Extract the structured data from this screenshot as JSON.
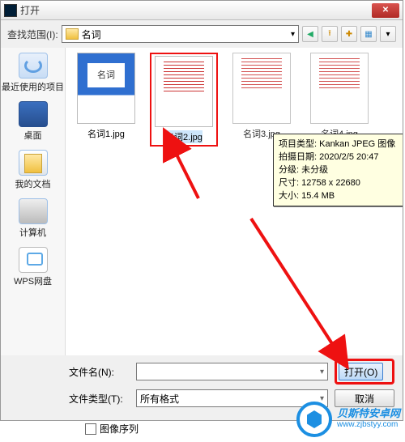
{
  "window": {
    "title": "打开"
  },
  "lookin": {
    "label": "查找范围(I):",
    "folder": "名词",
    "buttons": {
      "back": "←",
      "up": "↑",
      "new": "✚",
      "view": "▦",
      "extra": "▼"
    }
  },
  "sidebar": {
    "recent": "最近使用的项目",
    "desktop": "桌面",
    "mydocs": "我的文档",
    "computer": "计算机",
    "wps": "WPS网盘"
  },
  "files": [
    {
      "name": "名词1.jpg"
    },
    {
      "name": "名词2.jpg"
    },
    {
      "name": "名词3.jpg"
    },
    {
      "name": "名词4.jpg"
    }
  ],
  "tooltip": {
    "line1": "项目类型: Kankan JPEG 图像",
    "line2": "拍摄日期: 2020/2/5 20:47",
    "line3": "分级: 未分级",
    "line4": "尺寸: 12758 x 22680",
    "line5": "大小: 15.4 MB"
  },
  "bottom": {
    "filename_label": "文件名(N):",
    "filename_value": "",
    "filetype_label": "文件类型(T):",
    "filetype_value": "所有格式",
    "open_btn": "打开(O)",
    "cancel_btn": "取消",
    "sequence_label": "图像序列"
  },
  "watermark": {
    "name": "贝斯特安卓网",
    "url": "www.zjbstyy.com"
  }
}
